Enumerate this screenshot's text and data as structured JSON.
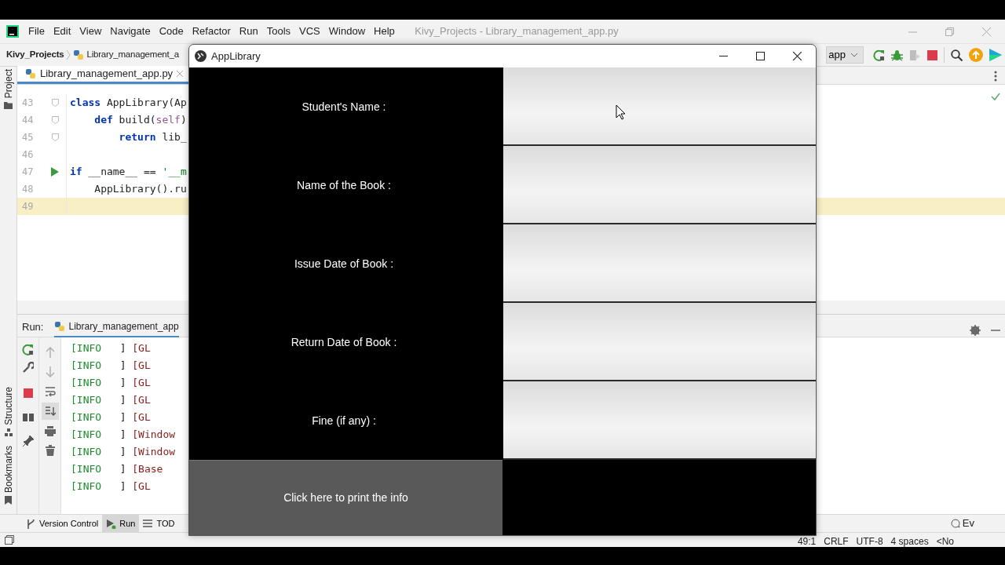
{
  "ide": {
    "title": "Kivy_Projects - Library_management_app.py",
    "menu": [
      "File",
      "Edit",
      "View",
      "Navigate",
      "Code",
      "Refactor",
      "Run",
      "Tools",
      "VCS",
      "Window",
      "Help"
    ],
    "breadcrumbs": [
      {
        "text": "Kivy_Projects",
        "kind": "project"
      },
      {
        "text": "Library_management_a",
        "kind": "file"
      }
    ],
    "run_config": "app",
    "side_tools_top": [
      "Project"
    ],
    "side_tools_bottom": [
      "Structure",
      "Bookmarks"
    ],
    "editor_tab": "Library_management_app.py",
    "code_lines": [
      {
        "number": "43",
        "kind": "fold",
        "current": false,
        "tokens": [
          {
            "text": "class",
            "kind": "keyword"
          },
          {
            "text": " AppLibrary(Ap",
            "kind": "plain"
          }
        ]
      },
      {
        "number": "44",
        "kind": "fold",
        "current": false,
        "tokens": [
          {
            "text": "    def",
            "kind": "keyword"
          },
          {
            "text": " build(",
            "kind": "plain"
          },
          {
            "text": "self",
            "kind": "self"
          },
          {
            "text": ")",
            "kind": "plain"
          }
        ]
      },
      {
        "number": "45",
        "kind": "fold",
        "current": false,
        "tokens": [
          {
            "text": "        return",
            "kind": "keyword"
          },
          {
            "text": " lib_",
            "kind": "plain"
          }
        ]
      },
      {
        "number": "46",
        "kind": "plain",
        "current": false
      },
      {
        "number": "47",
        "kind": "run",
        "current": false,
        "tokens": [
          {
            "text": "if",
            "kind": "keyword"
          },
          {
            "text": " __name__ == ",
            "kind": "plain"
          },
          {
            "text": "'__m",
            "kind": "string"
          }
        ]
      },
      {
        "number": "48",
        "kind": "plain",
        "current": false,
        "tokens": [
          {
            "text": "    AppLibrary().ru",
            "kind": "plain"
          }
        ]
      },
      {
        "number": "49",
        "kind": "plain",
        "current": true
      }
    ],
    "run_panel": {
      "label": "Run:",
      "tab": "Library_management_app",
      "secondary_tools": [
        {
          "kind": "up",
          "selected": false
        },
        {
          "kind": "down",
          "selected": false
        },
        {
          "kind": "wrap",
          "selected": false
        },
        {
          "kind": "scroll-end",
          "selected": true
        },
        {
          "kind": "print",
          "selected": false
        },
        {
          "kind": "trash",
          "selected": false
        }
      ],
      "log": [
        {
          "level": "[INFO",
          "close": "]",
          "source": "[GL"
        },
        {
          "level": "[INFO",
          "close": "]",
          "source": "[GL"
        },
        {
          "level": "[INFO",
          "close": "]",
          "source": "[GL"
        },
        {
          "level": "[INFO",
          "close": "]",
          "source": "[GL"
        },
        {
          "level": "[INFO",
          "close": "]",
          "source": "[GL"
        },
        {
          "level": "[INFO",
          "close": "]",
          "source": "[Window"
        },
        {
          "level": "[INFO",
          "close": "]",
          "source": "[Window"
        },
        {
          "level": "[INFO",
          "close": "]",
          "source": "[Base"
        },
        {
          "level": "[INFO",
          "close": "]",
          "source": "[GL"
        }
      ]
    },
    "bottom_tools": [
      {
        "label": "Version Control",
        "kind": "vcs",
        "selected": false
      },
      {
        "label": "Run",
        "kind": "run",
        "selected": true
      },
      {
        "label": "TOD",
        "kind": "todo",
        "selected": false
      }
    ],
    "event_log": "Ev",
    "status": [
      "49:1",
      "CRLF",
      "UTF-8",
      "4 spaces",
      "<No"
    ]
  },
  "app_window": {
    "title": "AppLibrary",
    "fields": [
      {
        "label": "Student's Name :"
      },
      {
        "label": "Name of the Book :"
      },
      {
        "label": "Issue Date of Book :"
      },
      {
        "label": "Return Date of Book :"
      },
      {
        "label": "Fine (if any) :"
      }
    ],
    "button": "Click here to print the info"
  }
}
